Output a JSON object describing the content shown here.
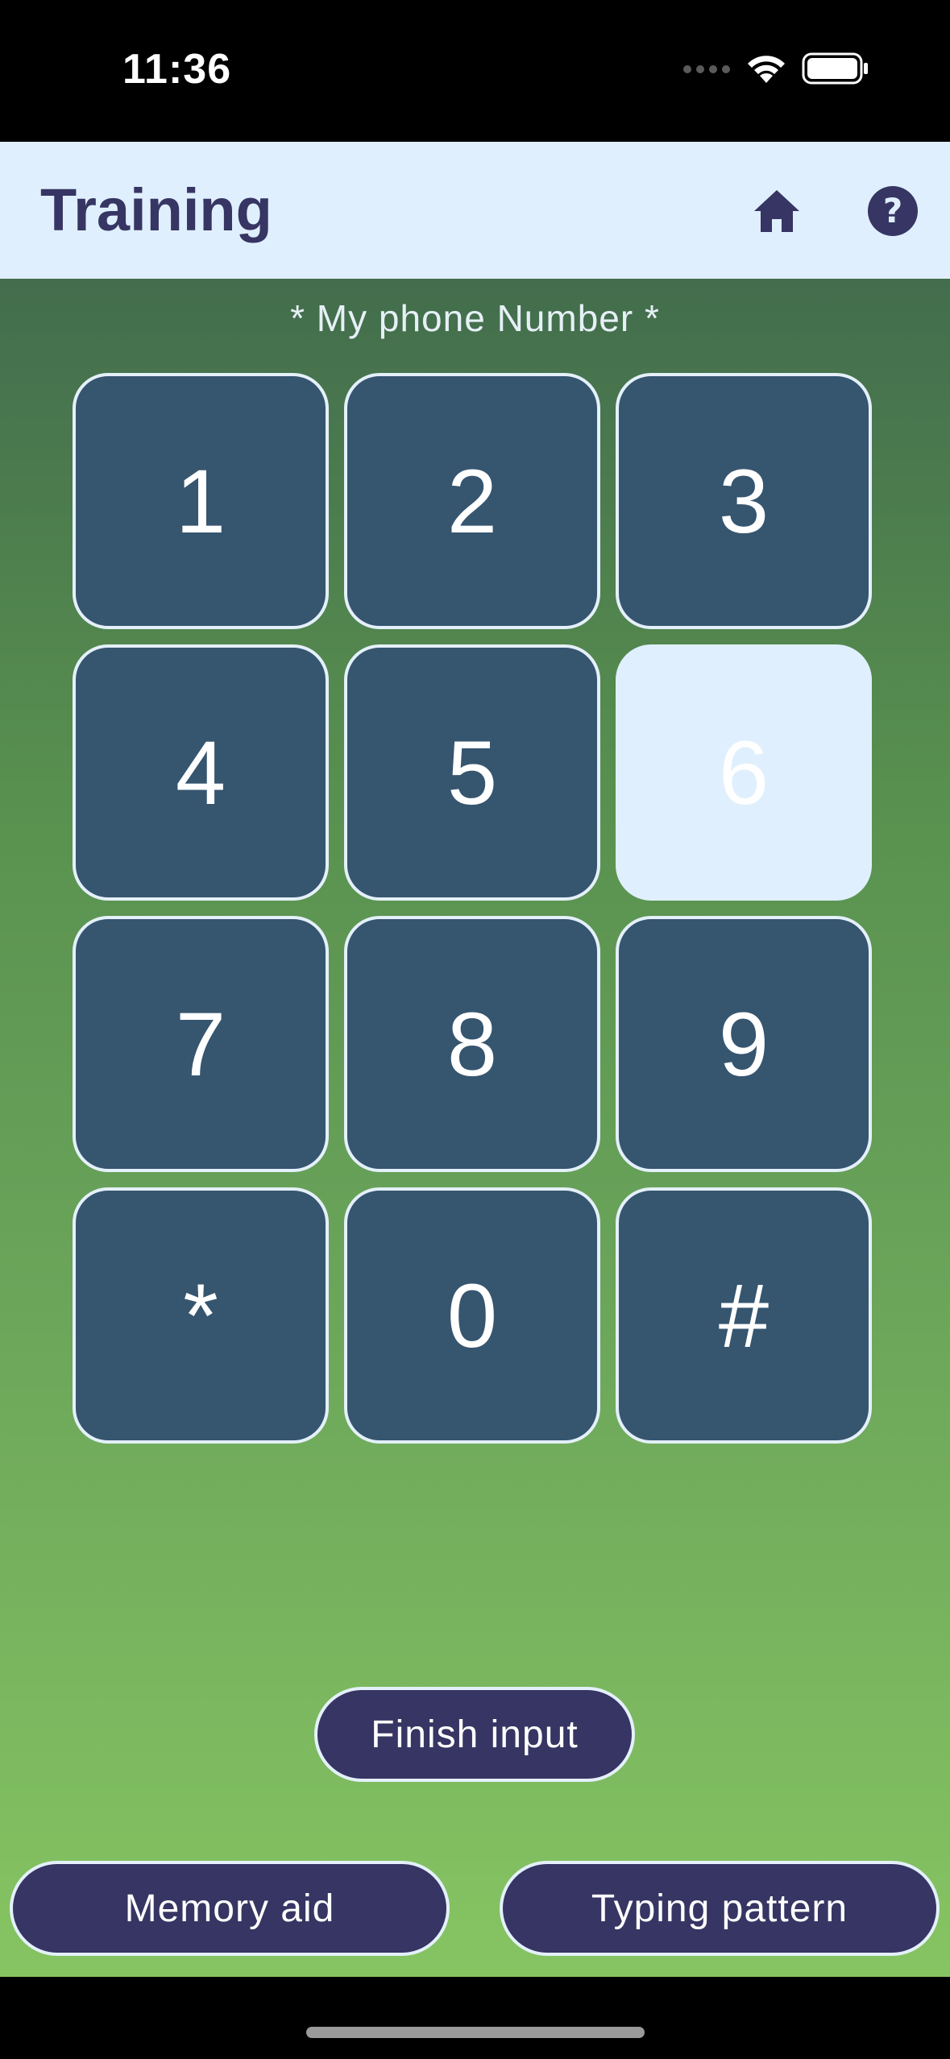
{
  "status_bar": {
    "time": "11:36",
    "icons": [
      "signal-dots-icon",
      "wifi-icon",
      "battery-icon"
    ]
  },
  "header": {
    "title": "Training",
    "icons": [
      "home-icon",
      "help-icon"
    ]
  },
  "main": {
    "subtitle": "* My phone Number *",
    "keys": [
      {
        "label": "1",
        "highlighted": false
      },
      {
        "label": "2",
        "highlighted": false
      },
      {
        "label": "3",
        "highlighted": false
      },
      {
        "label": "4",
        "highlighted": false
      },
      {
        "label": "5",
        "highlighted": false
      },
      {
        "label": "6",
        "highlighted": true
      },
      {
        "label": "7",
        "highlighted": false
      },
      {
        "label": "8",
        "highlighted": false
      },
      {
        "label": "9",
        "highlighted": false
      },
      {
        "label": "*",
        "highlighted": false
      },
      {
        "label": "0",
        "highlighted": false
      },
      {
        "label": "#",
        "highlighted": false
      }
    ]
  },
  "buttons": {
    "finish": "Finish input",
    "memory_aid": "Memory aid",
    "typing_pattern": "Typing pattern"
  },
  "colors": {
    "header_bg": "#dfeffd",
    "accent": "#363563",
    "key_bg": "#36556f",
    "key_highlight": "#dfeffd"
  }
}
